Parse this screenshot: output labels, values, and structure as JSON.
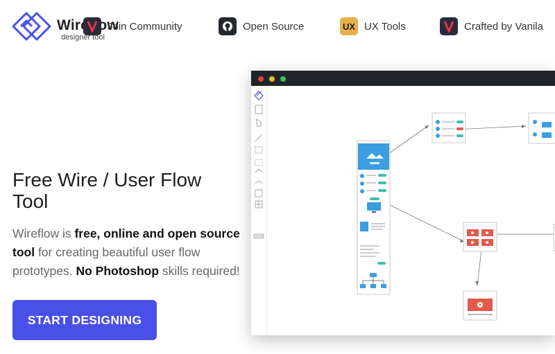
{
  "brand": {
    "name": "Wireflow",
    "tagline": "designer tool",
    "accent": "#4a4fe8"
  },
  "nav": {
    "items": [
      {
        "label": "Join Community",
        "icon": "vanila-icon"
      },
      {
        "label": "Open Source",
        "icon": "github-icon"
      },
      {
        "label": "UX Tools",
        "icon": "ux-tools-icon",
        "icon_text": "UX"
      },
      {
        "label": "Crafted by Vanila",
        "icon": "vanila-icon"
      }
    ]
  },
  "hero": {
    "title": "Free Wire / User Flow Tool",
    "desc_part1": "Wireflow is ",
    "desc_bold1": "free, online and open source tool",
    "desc_part2": " for creating beautiful user flow prototypes. ",
    "desc_bold2": "No Photoshop",
    "desc_part3": " skills required!",
    "cta_label": "START DESIGNING"
  },
  "app_preview": {
    "window_dots": [
      "#e2453c",
      "#e5c038",
      "#3fbf4f"
    ],
    "canvas_colors": {
      "blue": "#3a9ee0",
      "red": "#e15a4b",
      "teal": "#3dbfb0"
    }
  }
}
